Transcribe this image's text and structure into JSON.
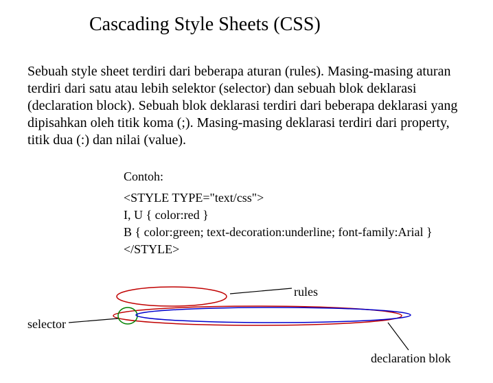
{
  "title": "Cascading Style Sheets (CSS)",
  "paragraph": "Sebuah style sheet terdiri dari beberapa aturan (rules). Masing-masing aturan terdiri dari satu atau lebih selektor (selector) dan sebuah blok deklarasi (declaration block). Sebuah blok deklarasi terdiri dari beberapa deklarasi yang dipisahkan oleh titik koma (;). Masing-masing deklarasi terdiri dari property, titik dua (:) dan nilai (value).",
  "example_label": "Contoh:",
  "code": {
    "line1": "<STYLE TYPE=\"text/css\">",
    "line2": "I, U { color:red }",
    "line3": "B { color:green; text-decoration:underline; font-family:Arial }",
    "line4": "</STYLE>"
  },
  "labels": {
    "rules": "rules",
    "selector": "selector",
    "declaration_block": "declaration blok"
  }
}
